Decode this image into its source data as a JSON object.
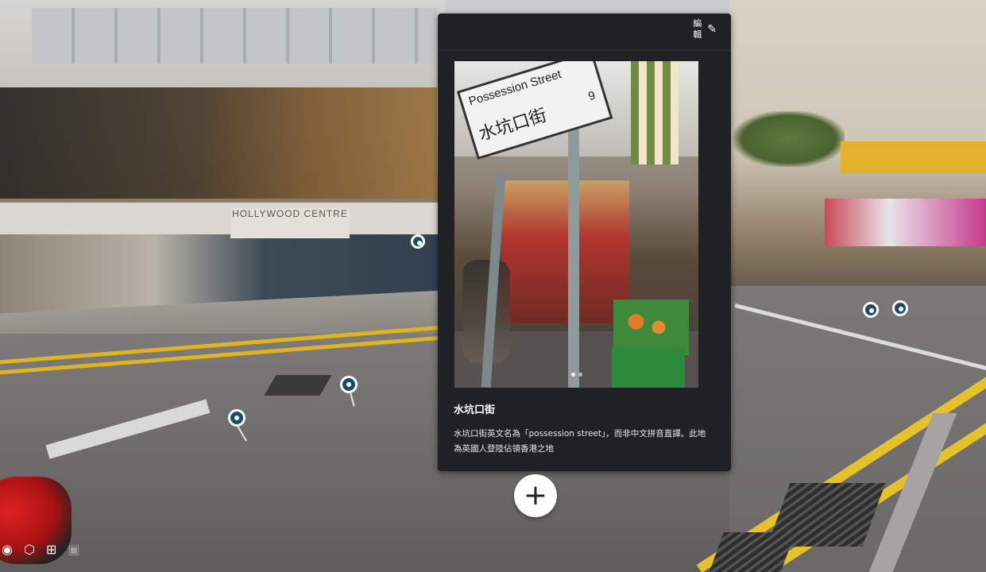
{
  "overlay": {
    "banner_text": "",
    "edit_label": "編輯",
    "edit_icon": "pencil-icon",
    "photo": {
      "sign_english": "Possession Street",
      "sign_chinese": "水坑口街",
      "sign_number": "9",
      "carousel_dots": 2,
      "active_dot": 1
    },
    "title": "水坑口街",
    "description": "水坑口街英文名為「possession street」，而非中文拼音直譯。此地為英國人登陸佔領香港之地"
  },
  "add_button": {
    "icon": "plus-icon",
    "label": "+"
  },
  "scene_sign": {
    "text": "HOLLYWOOD CENTRE"
  },
  "toolbar": {
    "icons": [
      "camera-icon",
      "cube-icon",
      "layout-icon",
      "image-icon"
    ]
  },
  "colors": {
    "card_bg": "#202124",
    "pin_fill": "#1b4d5c",
    "road_marking": "#e0b420"
  }
}
